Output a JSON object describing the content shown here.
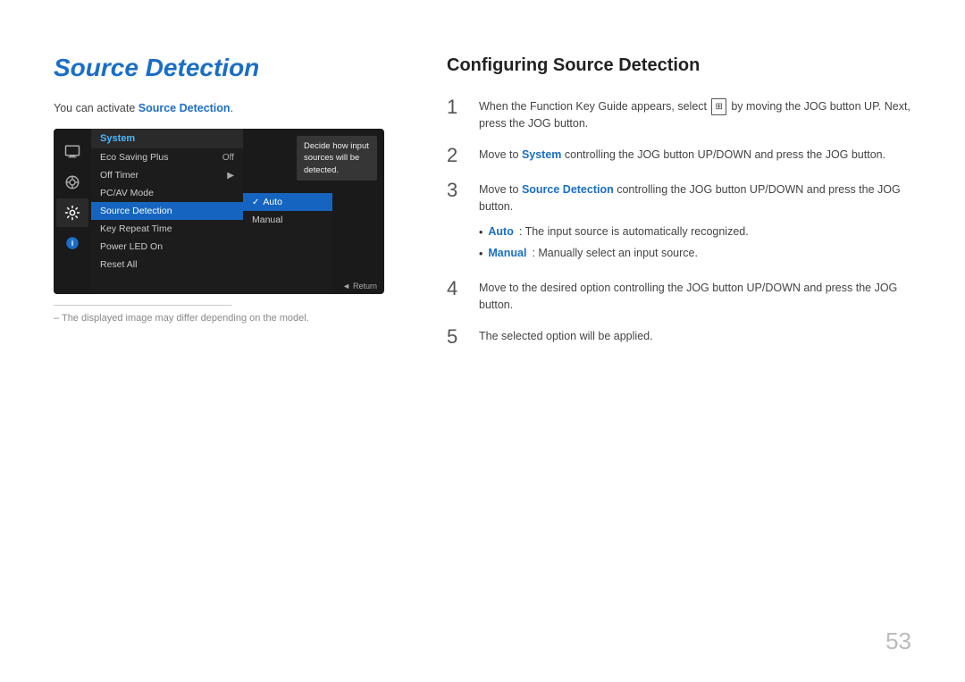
{
  "page": {
    "number": "53"
  },
  "left": {
    "title": "Source Detection",
    "intro": "You can activate ",
    "intro_bold": "Source Detection",
    "intro_end": ".",
    "monitor": {
      "menu_header": "System",
      "menu_items": [
        {
          "label": "Eco Saving Plus",
          "value": "Off",
          "arrow": false
        },
        {
          "label": "Off Timer",
          "value": "",
          "arrow": true
        },
        {
          "label": "PC/AV Mode",
          "value": "",
          "arrow": false
        },
        {
          "label": "Source Detection",
          "value": "",
          "selected": true
        },
        {
          "label": "Key Repeat Time",
          "value": "",
          "arrow": false
        },
        {
          "label": "Power LED On",
          "value": "",
          "arrow": false
        },
        {
          "label": "Reset All",
          "value": "",
          "arrow": false
        }
      ],
      "submenu_items": [
        {
          "label": "Auto",
          "checked": true,
          "selected": true
        },
        {
          "label": "Manual",
          "checked": false
        }
      ],
      "tooltip": "Decide how input sources will be detected.",
      "return_label": "Return"
    },
    "footnote": "– The displayed image may differ depending on the model."
  },
  "right": {
    "title": "Configuring Source Detection",
    "steps": [
      {
        "number": "1",
        "text": "When the Function Key Guide appears, select",
        "icon": true,
        "text_after": "by moving the JOG button UP. Next, press the JOG button."
      },
      {
        "number": "2",
        "text": "Move to",
        "bold": "System",
        "text_after": "controlling the JOG button UP/DOWN and press the JOG button."
      },
      {
        "number": "3",
        "text": "Move to",
        "bold": "Source Detection",
        "text_after": "controlling the JOG button UP/DOWN and press the JOG button."
      },
      {
        "number": "4",
        "text": "Move to the desired option controlling the JOG button UP/DOWN and press the JOG button."
      },
      {
        "number": "5",
        "text": "The selected option will be applied."
      }
    ],
    "bullets": [
      {
        "bold": "Auto",
        "text": ": The input source is automatically recognized."
      },
      {
        "bold": "Manual",
        "text": ": Manually select an input source."
      }
    ]
  }
}
